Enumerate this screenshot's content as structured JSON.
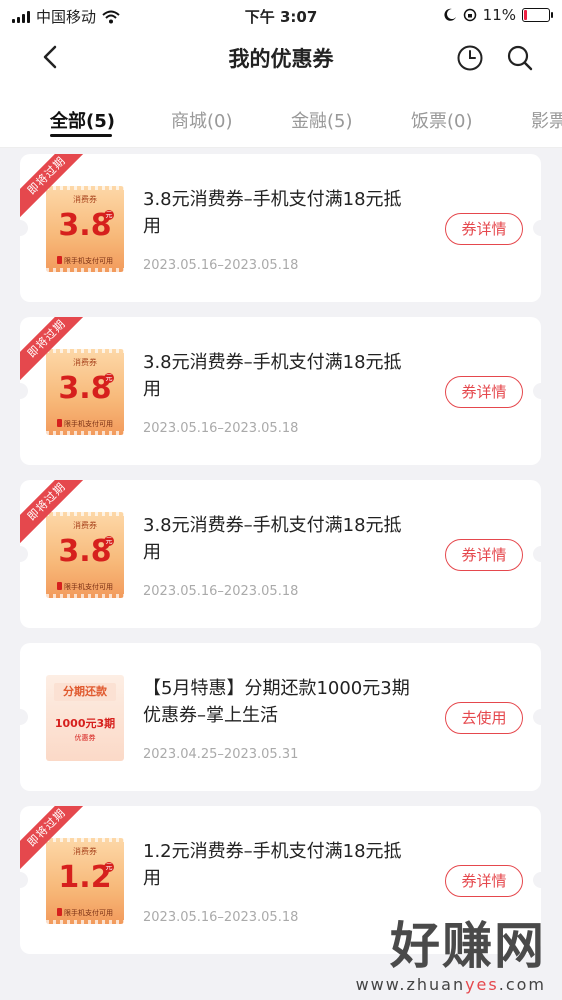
{
  "status_bar": {
    "carrier": "中国移动",
    "time": "下午 3:07",
    "battery": "11%",
    "battery_level": 0.11
  },
  "header": {
    "title": "我的优惠券",
    "back_icon": "chevron-left-icon",
    "history_icon": "clock-icon",
    "search_icon": "search-icon"
  },
  "tabs": [
    {
      "label": "全部(5)",
      "active": true
    },
    {
      "label": "商城(0)",
      "active": false
    },
    {
      "label": "金融(5)",
      "active": false
    },
    {
      "label": "饭票(0)",
      "active": false
    },
    {
      "label": "影票",
      "active": false
    }
  ],
  "coupons": [
    {
      "ribbon": "即将过期",
      "img_label": "消费券",
      "amount": "3.8",
      "unit": "元",
      "img_footer": "限手机支付可用",
      "title": "3.8元消费券–手机支付满18元抵用",
      "date": "2023.05.16–2023.05.18",
      "button": "券详情"
    },
    {
      "ribbon": "即将过期",
      "img_label": "消费券",
      "amount": "3.8",
      "unit": "元",
      "img_footer": "限手机支付可用",
      "title": "3.8元消费券–手机支付满18元抵用",
      "date": "2023.05.16–2023.05.18",
      "button": "券详情"
    },
    {
      "ribbon": "即将过期",
      "img_label": "消费券",
      "amount": "3.8",
      "unit": "元",
      "img_footer": "限手机支付可用",
      "title": "3.8元消费券–手机支付满18元抵用",
      "date": "2023.05.16–2023.05.18",
      "button": "券详情"
    },
    {
      "img_badge": "分期还款",
      "img_text": "1000元3期",
      "img_sub": "优惠券",
      "title": "【5月特惠】分期还款1000元3期优惠券–掌上生活",
      "date": "2023.04.25–2023.05.31",
      "button": "去使用"
    },
    {
      "ribbon": "即将过期",
      "img_label": "消费券",
      "amount": "1.2",
      "unit": "元",
      "img_footer": "限手机支付可用",
      "title": "1.2元消费券–手机支付满18元抵用",
      "date": "2023.05.16–2023.05.18",
      "button": "券详情"
    }
  ],
  "watermark": {
    "main": "好赚网",
    "site_pre": "www.zhuan",
    "site_accent": "yes",
    "site_post": ".com"
  }
}
